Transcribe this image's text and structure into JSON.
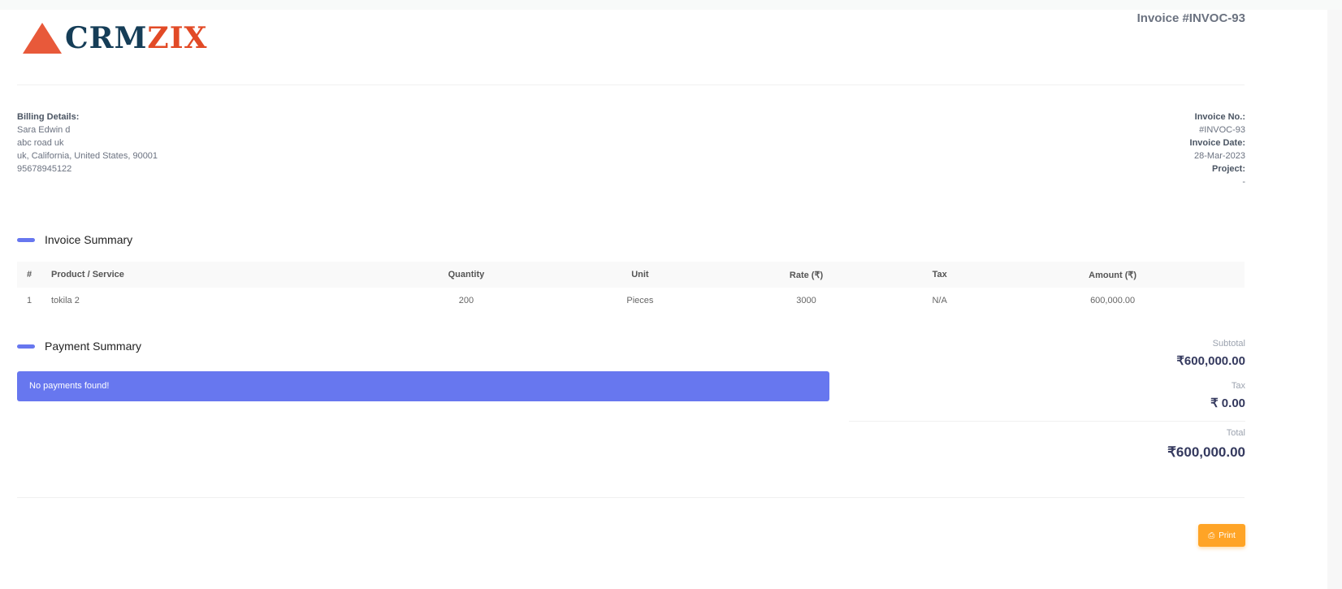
{
  "logo": {
    "text_a": "CRM",
    "text_b": "ZIX"
  },
  "header": {
    "title": "Invoice #INVOC-93"
  },
  "billing": {
    "label": "Billing Details:",
    "name": "Sara Edwin d",
    "address1": "abc road uk",
    "address2": "uk, California, United States, 90001",
    "phone": "95678945122"
  },
  "meta": {
    "invoice_no_label": "Invoice No.:",
    "invoice_no": "#INVOC-93",
    "date_label": "Invoice Date:",
    "date": "28-Mar-2023",
    "project_label": "Project:",
    "project": "-"
  },
  "invoice_summary": {
    "title": "Invoice Summary",
    "columns": [
      "#",
      "Product / Service",
      "Quantity",
      "Unit",
      "Rate (₹)",
      "Tax",
      "Amount (₹)"
    ],
    "rows": [
      [
        "1",
        "tokila 2",
        "200",
        "Pieces",
        "3000",
        "N/A",
        "600,000.00"
      ]
    ]
  },
  "payment_summary": {
    "title": "Payment Summary",
    "empty": "No payments found!"
  },
  "totals": {
    "subtotal_label": "Subtotal",
    "subtotal": "₹600,000.00",
    "tax_label": "Tax",
    "tax": "₹ 0.00",
    "total_label": "Total",
    "total": "₹600,000.00"
  },
  "print_label": "Print",
  "colors": {
    "accent": "#6777ef",
    "print": "#ffa426"
  }
}
